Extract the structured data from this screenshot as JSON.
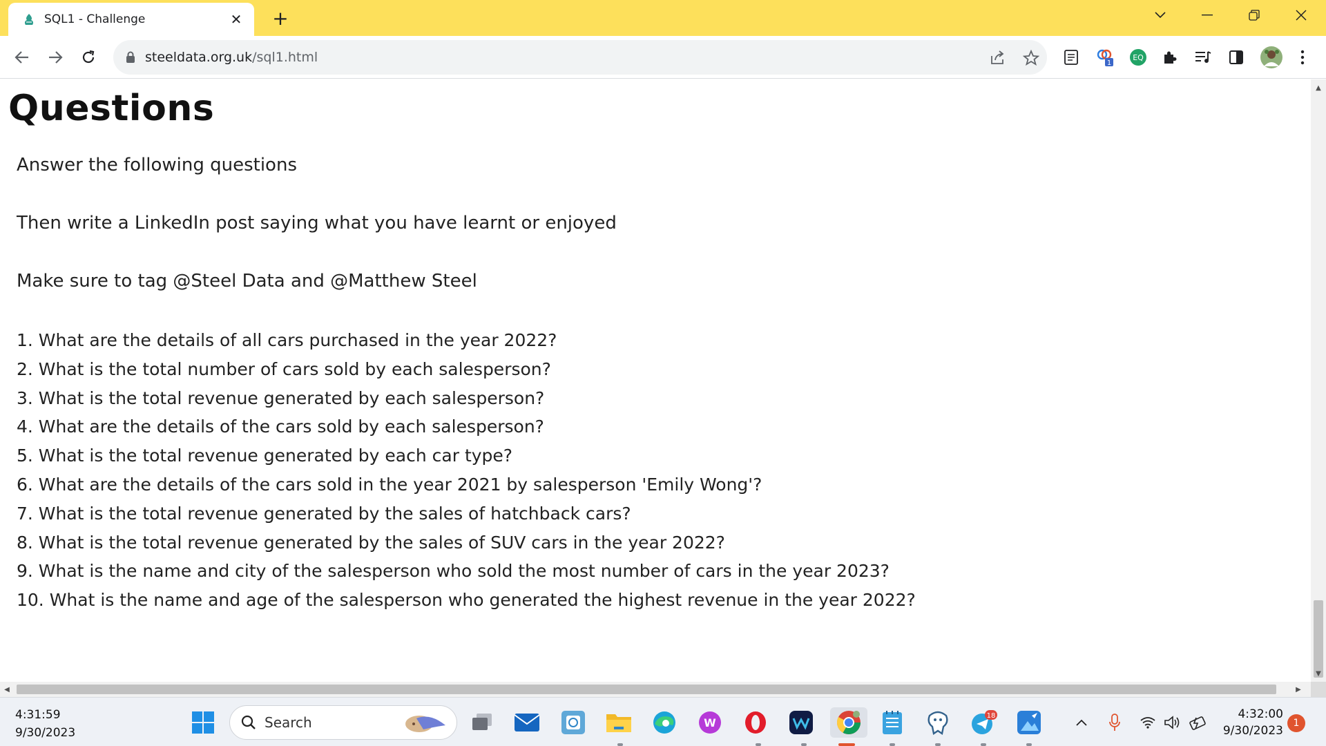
{
  "browser": {
    "tab": {
      "title": "SQL1 - Challenge"
    },
    "url": {
      "host": "steeldata.org.uk",
      "path": "/sql1.html"
    }
  },
  "page": {
    "heading": "Questions",
    "intro": [
      "Answer the following questions",
      "Then write a LinkedIn post saying what you have learnt or enjoyed",
      "Make sure to tag @Steel Data and @Matthew Steel"
    ],
    "questions": [
      "1. What are the details of all cars purchased in the year 2022?",
      "2. What is the total number of cars sold by each salesperson?",
      "3. What is the total revenue generated by each salesperson?",
      "4. What are the details of the cars sold by each salesperson?",
      "5. What is the total revenue generated by each car type?",
      "6. What are the details of the cars sold in the year 2021 by salesperson 'Emily Wong'?",
      "7. What is the total revenue generated by the sales of hatchback cars?",
      "8. What is the total revenue generated by the sales of SUV cars in the year 2022?",
      "9. What is the name and city of the salesperson who sold the most number of cars in the year 2023?",
      "10. What is the name and age of the salesperson who generated the highest revenue in the year 2022?"
    ]
  },
  "extensions": {
    "badge_count": "1"
  },
  "taskbar": {
    "left_time": "4:31:59",
    "left_date": "9/30/2023",
    "search_label": "Search",
    "telegram_badge": "18",
    "right_time": "4:32:00",
    "right_date": "9/30/2023",
    "notification_count": "1"
  },
  "colors": {
    "tabstrip": "#fde05b",
    "accent": "#1a73e8"
  }
}
